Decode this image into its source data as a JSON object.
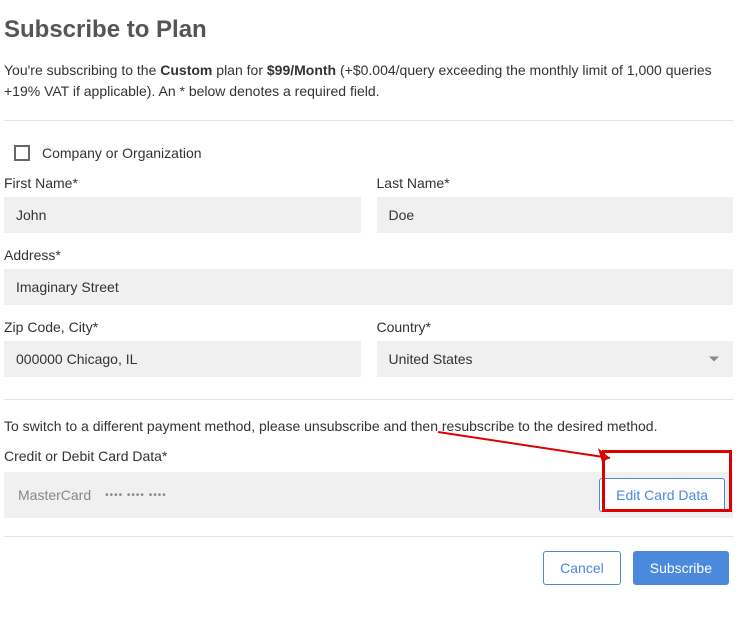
{
  "title": "Subscribe to Plan",
  "intro": {
    "prefix": "You're subscribing to the ",
    "plan": "Custom",
    "mid": " plan for ",
    "price": "$99/Month",
    "suffix": " (+$0.004/query exceeding the monthly limit of 1,000 queries +19% VAT if applicable). An * below denotes a required field."
  },
  "company_checkbox": {
    "label": "Company or Organization",
    "checked": false
  },
  "fields": {
    "first_name": {
      "label": "First Name*",
      "value": "John"
    },
    "last_name": {
      "label": "Last Name*",
      "value": "Doe"
    },
    "address": {
      "label": "Address*",
      "value": "Imaginary Street"
    },
    "zip_city": {
      "label": "Zip Code, City*",
      "value": "000000 Chicago, IL"
    },
    "country": {
      "label": "Country*",
      "value": "United States"
    }
  },
  "payment_note": "To switch to a different payment method, please unsubscribe and then resubscribe to the desired method.",
  "card": {
    "label": "Credit or Debit Card Data*",
    "brand": "MasterCard",
    "mask": "•••• •••• ••••",
    "edit_label": "Edit Card Data"
  },
  "footer": {
    "cancel": "Cancel",
    "subscribe": "Subscribe"
  }
}
